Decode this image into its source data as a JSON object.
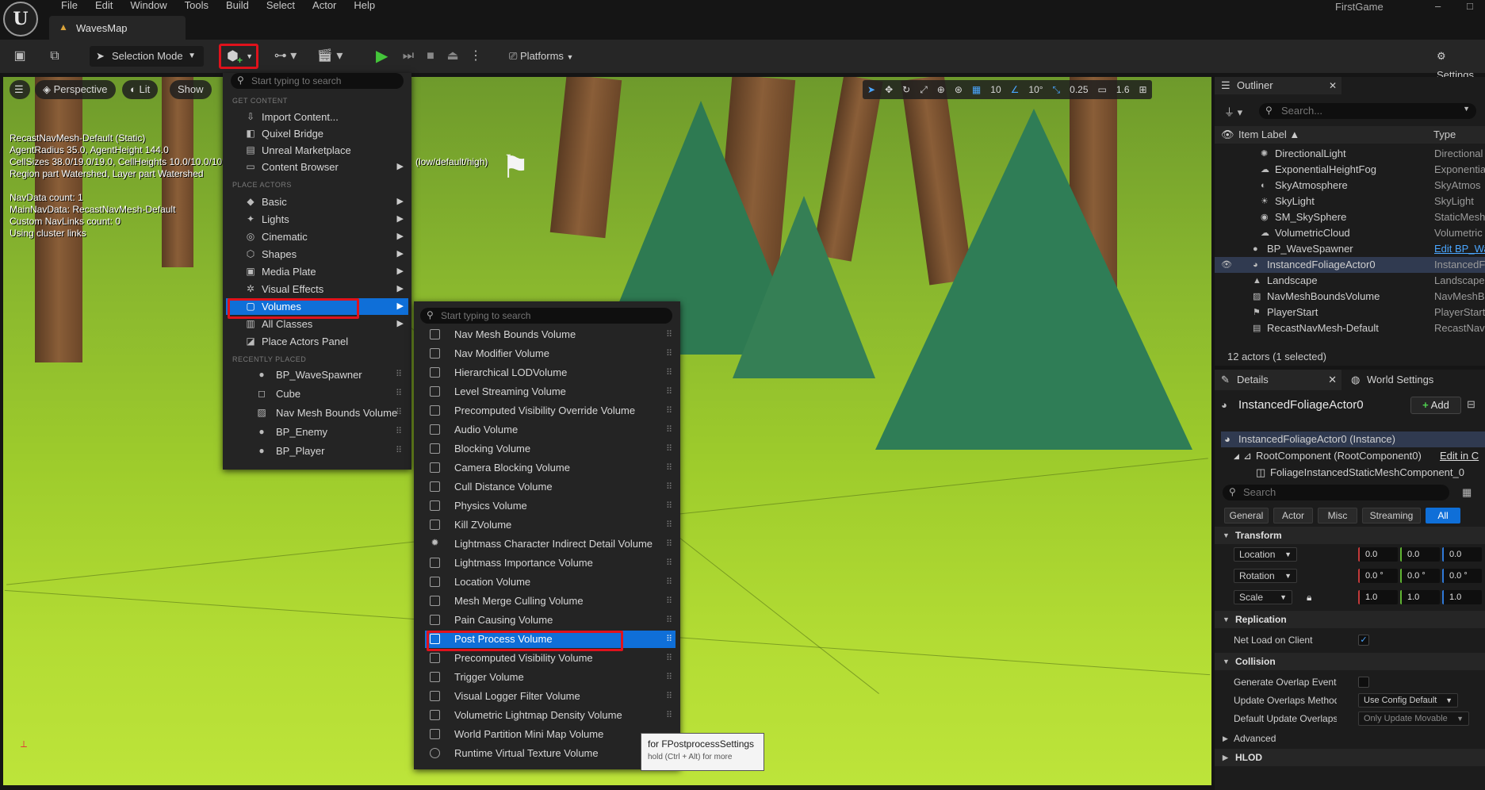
{
  "menubar": {
    "items": [
      "File",
      "Edit",
      "Window",
      "Tools",
      "Build",
      "Select",
      "Actor",
      "Help"
    ]
  },
  "window": {
    "project": "FirstGame",
    "minimize": "–",
    "maximize": "□"
  },
  "doc_tab": {
    "label": "WavesMap"
  },
  "toolbar": {
    "selection_mode": "Selection Mode",
    "platforms": "Platforms",
    "settings": "Settings"
  },
  "viewport": {
    "perspective": "Perspective",
    "lit": "Lit",
    "show": "Show",
    "info": "RecastNavMesh-Default (Static)\nAgentRadius 35.0, AgentHeight 144.0\nCellSizes 38.0/19.0/19.0, CellHeights 10.0/10.0/10.0\nRegion part Watershed, Layer part Watershed\n\nNavData count: 1\nMainNavData: RecastNavMesh-Default\nCustom NavLinks count: 0\nUsing cluster links",
    "lod_text": "(low/default/high)",
    "grid_snap": "10",
    "rot_snap": "10°",
    "scale_snap": "0.25",
    "cam_speed": "1.6"
  },
  "place_menu": {
    "search_placeholder": "Start typing to search",
    "get_content_header": "GET CONTENT",
    "get_content": [
      {
        "label": "Import Content...",
        "icon": "import-icon"
      },
      {
        "label": "Quixel Bridge",
        "icon": "bridge-icon"
      },
      {
        "label": "Unreal Marketplace",
        "icon": "marketplace-icon"
      },
      {
        "label": "Content Browser",
        "icon": "content-browser-icon"
      }
    ],
    "place_actors_header": "PLACE ACTORS",
    "place_actors": [
      {
        "label": "Basic",
        "icon": "cube-icon"
      },
      {
        "label": "Lights",
        "icon": "light-icon"
      },
      {
        "label": "Cinematic",
        "icon": "cinematic-icon"
      },
      {
        "label": "Shapes",
        "icon": "shapes-icon"
      },
      {
        "label": "Media Plate",
        "icon": "media-icon"
      },
      {
        "label": "Visual Effects",
        "icon": "vfx-icon"
      },
      {
        "label": "Volumes",
        "icon": "volume-icon"
      },
      {
        "label": "All Classes",
        "icon": "classes-icon"
      },
      {
        "label": "Place Actors Panel",
        "icon": "panel-icon"
      }
    ],
    "recent_header": "RECENTLY PLACED",
    "recent": [
      {
        "label": "BP_WaveSpawner"
      },
      {
        "label": "Cube"
      },
      {
        "label": "Nav Mesh Bounds Volume"
      },
      {
        "label": "BP_Enemy"
      },
      {
        "label": "BP_Player"
      }
    ]
  },
  "volumes_menu": {
    "search_placeholder": "Start typing to search",
    "items": [
      "Nav Mesh Bounds Volume",
      "Nav Modifier Volume",
      "Hierarchical LODVolume",
      "Level Streaming Volume",
      "Precomputed Visibility Override Volume",
      "Audio Volume",
      "Blocking Volume",
      "Camera Blocking Volume",
      "Cull Distance Volume",
      "Physics Volume",
      "Kill ZVolume",
      "Lightmass Character Indirect Detail Volume",
      "Lightmass Importance Volume",
      "Location Volume",
      "Mesh Merge Culling Volume",
      "Pain Causing Volume",
      "Post Process Volume",
      "Precomputed Visibility Volume",
      "Trigger Volume",
      "Visual Logger Filter Volume",
      "Volumetric Lightmap Density Volume",
      "World Partition Mini Map Volume",
      "Runtime Virtual Texture Volume"
    ],
    "selected": "Post Process Volume"
  },
  "tooltip": {
    "title": "for FPostprocessSettings",
    "hint": "hold (Ctrl + Alt) for more"
  },
  "outliner": {
    "tab": "Outliner",
    "search_placeholder": "Search...",
    "col_label": "Item Label ▲",
    "col_type": "Type",
    "rows": [
      {
        "name": "DirectionalLight",
        "type": "Directional",
        "indent": 2
      },
      {
        "name": "ExponentialHeightFog",
        "type": "Exponentia",
        "indent": 2
      },
      {
        "name": "SkyAtmosphere",
        "type": "SkyAtmos",
        "indent": 2
      },
      {
        "name": "SkyLight",
        "type": "SkyLight",
        "indent": 2
      },
      {
        "name": "SM_SkySphere",
        "type": "StaticMesh",
        "indent": 2
      },
      {
        "name": "VolumetricCloud",
        "type": "Volumetric",
        "indent": 2
      },
      {
        "name": "BP_WaveSpawner",
        "type": "Edit BP_Wa",
        "indent": 1,
        "link": true
      },
      {
        "name": "InstancedFoliageActor0",
        "type": "InstancedF",
        "indent": 1,
        "selected": true
      },
      {
        "name": "Landscape",
        "type": "Landscape",
        "indent": 1
      },
      {
        "name": "NavMeshBoundsVolume",
        "type": "NavMeshB",
        "indent": 1
      },
      {
        "name": "PlayerStart",
        "type": "PlayerStart",
        "indent": 1
      },
      {
        "name": "RecastNavMesh-Default",
        "type": "RecastNav",
        "indent": 1
      }
    ],
    "count": "12 actors (1 selected)"
  },
  "details": {
    "tab": "Details",
    "world_settings_tab": "World Settings",
    "actor_name": "InstancedFoliageActor0",
    "add_label": "Add",
    "components": [
      {
        "label": "InstancedFoliageActor0 (Instance)",
        "selected": true
      },
      {
        "label": "RootComponent (RootComponent0)",
        "edit": "Edit in C"
      },
      {
        "label": "FoliageInstancedStaticMeshComponent_0"
      }
    ],
    "search_placeholder": "Search",
    "filters": [
      "General",
      "Actor",
      "Misc",
      "Streaming",
      "All"
    ],
    "transform_header": "Transform",
    "location": {
      "label": "Location",
      "x": "0.0",
      "y": "0.0",
      "z": "0.0"
    },
    "rotation": {
      "label": "Rotation",
      "x": "0.0 °",
      "y": "0.0 °",
      "z": "0.0 °"
    },
    "scale": {
      "label": "Scale",
      "x": "1.0",
      "y": "1.0",
      "z": "1.0"
    },
    "replication_header": "Replication",
    "net_load": "Net Load on Client",
    "collision_header": "Collision",
    "gen_overlap": "Generate Overlap Events D...",
    "update_overlaps": "Update Overlaps Method D...",
    "update_overlaps_val": "Use Config Default",
    "default_update": "Default Update Overlaps M...",
    "default_update_val": "Only Update Movable",
    "advanced": "Advanced",
    "hlod_header": "HLOD"
  }
}
